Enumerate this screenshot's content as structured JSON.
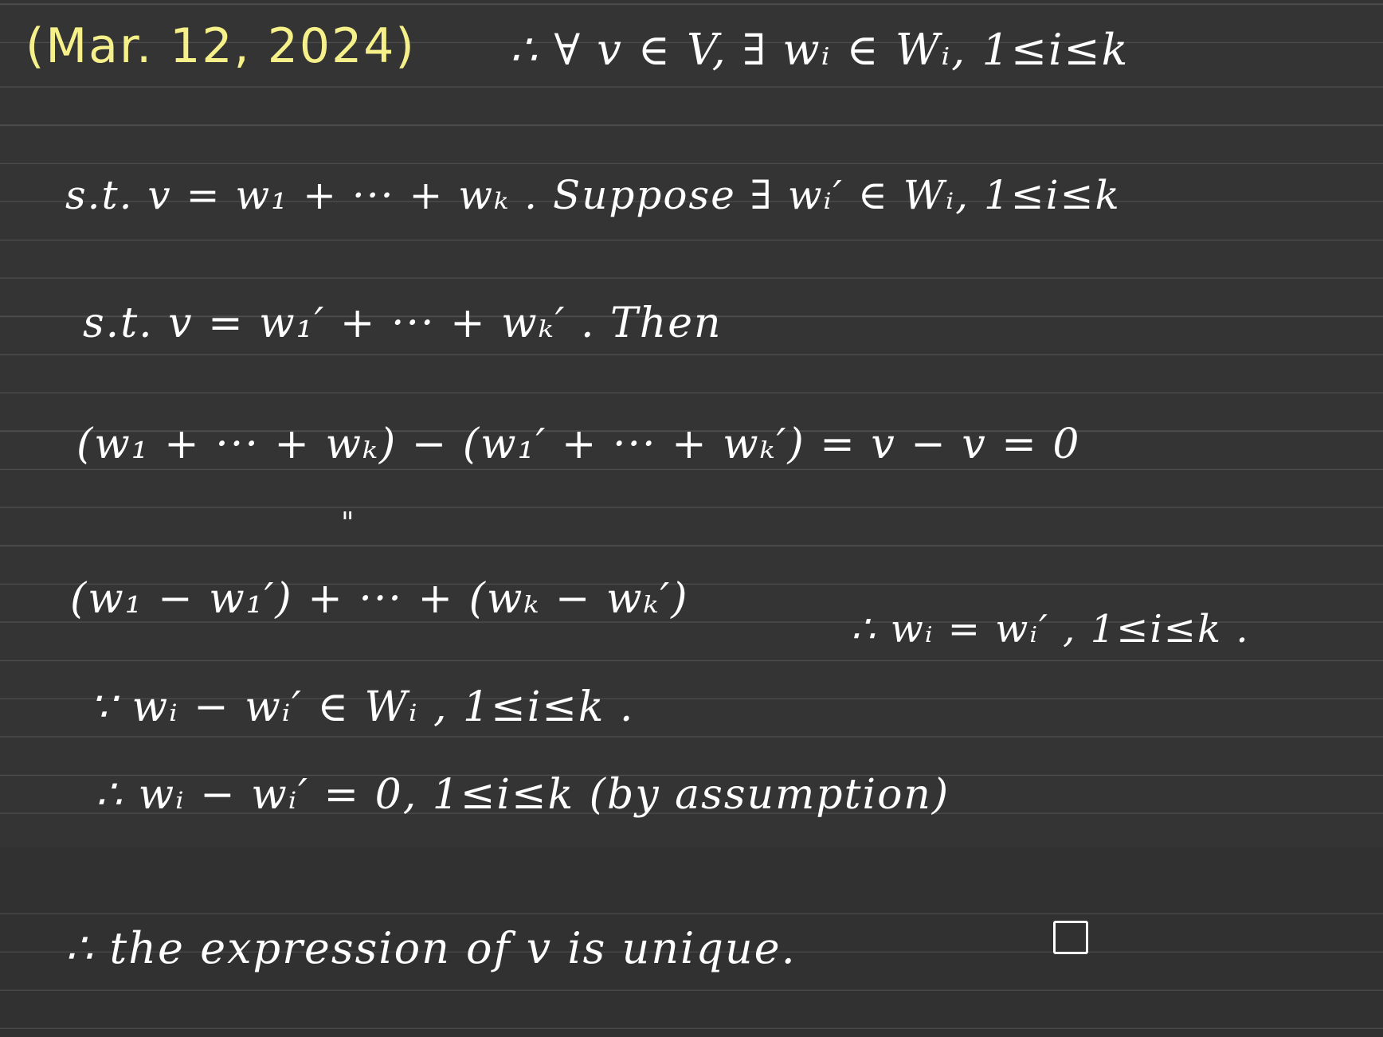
{
  "note": {
    "date": "(Mar. 12, 2024)",
    "lines": [
      "∴ ∀ v ∈ V, ∃ wᵢ ∈ Wᵢ, 1≤i≤k",
      "s.t. v = w₁ + ··· + wₖ . Suppose ∃ wᵢ′ ∈ Wᵢ, 1≤i≤k",
      "s.t. v = w₁′ + ··· + wₖ′ . Then",
      "(w₁ + ··· + wₖ) − (w₁′ + ··· + wₖ′) = v − v = 0",
      "\"",
      "(w₁ − w₁′) + ···  + (wₖ − wₖ′)",
      "∴ wᵢ = wᵢ′ , 1≤i≤k .",
      "∵ wᵢ − wᵢ′ ∈ Wᵢ , 1≤i≤k .",
      "∴ wᵢ − wᵢ′ = 0,  1≤i≤k  (by assumption)",
      "∴ the expression of v is unique."
    ],
    "end_mark": "□."
  }
}
